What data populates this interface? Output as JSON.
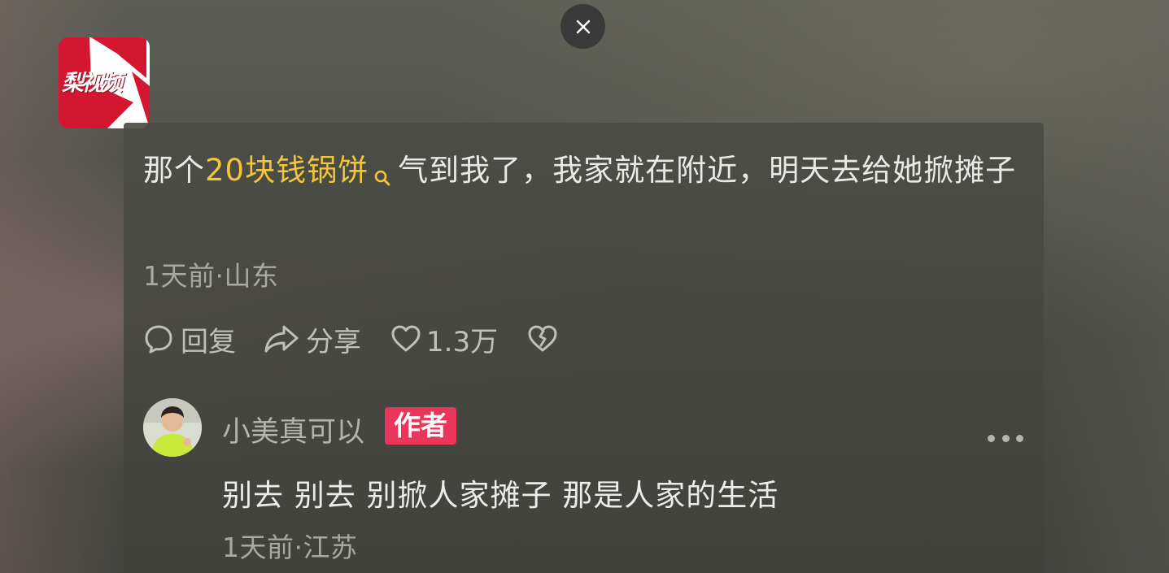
{
  "logo": {
    "text": "梨视频"
  },
  "close": {
    "icon": "close-icon"
  },
  "comment": {
    "text_before": "那个",
    "highlight": "20块钱锅饼",
    "text_after": "气到我了，我家就在附近，明天去给她掀摊子",
    "meta": "1天前·山东",
    "actions": {
      "reply_label": "回复",
      "share_label": "分享",
      "like_count": "1.3万"
    }
  },
  "reply": {
    "username": "小美真可以",
    "badge": "作者",
    "text": "别去 别去 别掀人家摊子 那是人家的生活",
    "meta": "1天前·江苏"
  },
  "colors": {
    "highlight": "#f2c53a",
    "badge": "#e9365a",
    "logo": "#d31730"
  }
}
